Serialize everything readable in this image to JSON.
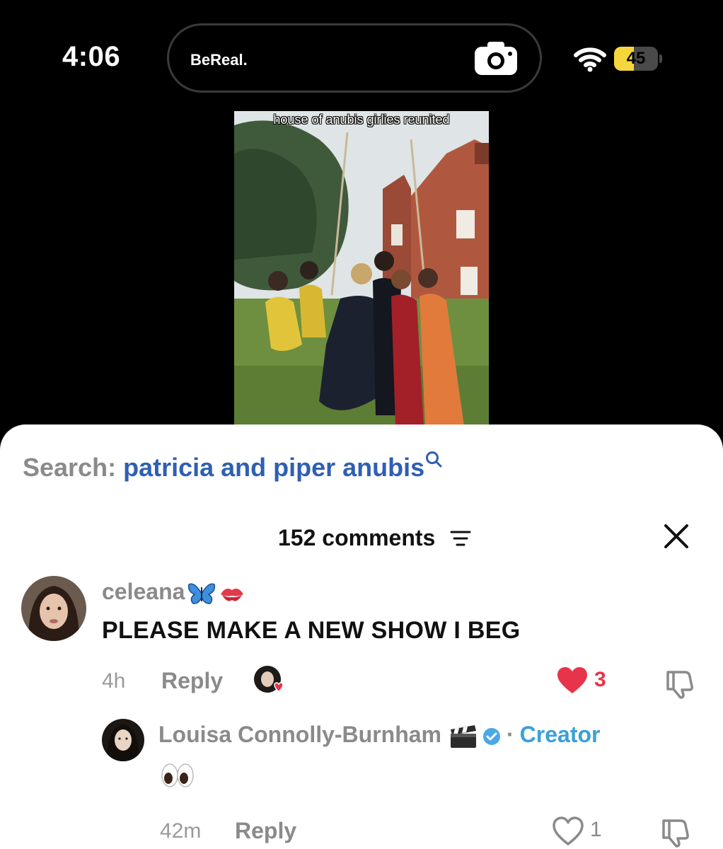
{
  "status_bar": {
    "time": "4:06",
    "app_label": "BeReal.",
    "battery_level": "45",
    "battery_fraction": 0.45,
    "battery_color": "#f5d63c"
  },
  "photo": {
    "caption": "house of anubis girlies reunited"
  },
  "search": {
    "label": "Search:",
    "term": "patricia and piper anubis",
    "term_color": "#2f5fb3"
  },
  "comments_header": {
    "count_label": "152 comments"
  },
  "comments": [
    {
      "username": "celeana",
      "text": "PLEASE MAKE A NEW SHOW I BEG",
      "age": "4h",
      "reply_label": "Reply",
      "likes": "3",
      "liked": true,
      "like_color": "#e8344b"
    }
  ],
  "replies": [
    {
      "username": "Louisa Connolly-Burnham",
      "separator": "·",
      "badge": "Creator",
      "badge_color": "#3aa0d8",
      "text_emoji": "eyes",
      "age": "42m",
      "reply_label": "Reply",
      "likes": "1",
      "liked": false
    }
  ]
}
